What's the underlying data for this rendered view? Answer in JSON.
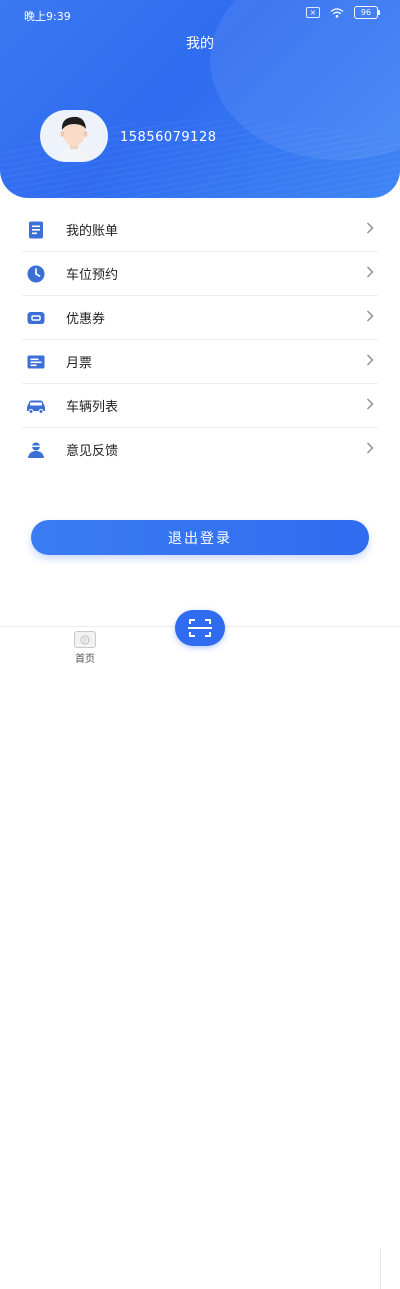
{
  "status_bar": {
    "time": "晚上9:39",
    "battery": "96"
  },
  "header": {
    "title": "我的",
    "phone": "15856079128"
  },
  "menu": [
    {
      "label": "我的账单",
      "icon": "bill-icon"
    },
    {
      "label": "车位预约",
      "icon": "clock-icon"
    },
    {
      "label": "优惠券",
      "icon": "coupon-icon"
    },
    {
      "label": "月票",
      "icon": "monthly-ticket-icon"
    },
    {
      "label": "车辆列表",
      "icon": "car-icon"
    },
    {
      "label": "意见反馈",
      "icon": "feedback-icon"
    }
  ],
  "logout_label": "退出登录",
  "tabbar": {
    "home_label": "首页"
  },
  "colors": {
    "primary": "#2f6cf0",
    "menu_icon": "#3b6fd6"
  }
}
